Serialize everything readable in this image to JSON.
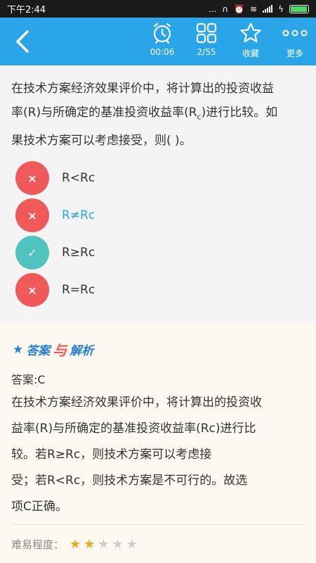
{
  "status_bar": {
    "time": "下午2:44",
    "dots": "...",
    "battery_level": 0.95
  },
  "toolbar": {
    "back_icon": "‹",
    "tools": [
      {
        "icon": "alarm-clock-icon",
        "label": "00:06"
      },
      {
        "icon": "grid-icon",
        "label": "2/55"
      },
      {
        "icon": "star-icon",
        "label": "收藏"
      },
      {
        "icon": "more-icon",
        "label": "更多"
      }
    ]
  },
  "question": {
    "text_line1": "在技术方案经济效果评价中，将计算出的投资收益",
    "text_line2_pre": "率(R)与所确定的基准投资收益率(R",
    "text_line2_sub": "c",
    "text_line2_post": ")进行比较。如",
    "text_line3": "果技术方案可以考虑接受，则(   )。",
    "options": [
      {
        "mark": "×",
        "text": "R<Rc",
        "state": "wrong"
      },
      {
        "mark": "×",
        "text": "R≠Rc",
        "state": "wrong-selected"
      },
      {
        "mark": "✓",
        "text": "R≥Rc",
        "state": "correct"
      },
      {
        "mark": "×",
        "text": "R=Rc",
        "state": "wrong"
      }
    ]
  },
  "answer": {
    "title_star": "★",
    "title_part1": "答案",
    "title_part2": "与",
    "title_part3": "解析",
    "key": "答案:C",
    "analysis_line1": "在技术方案经济效果评价中，将计算出的投资收",
    "analysis_line2": "益率(R)与所确定的基准投资收益率(Rc)进行比",
    "analysis_line3": "较。若R≥Rc，则技术方案可以考虑接",
    "analysis_line4": "受；若R<Rc，则技术方案是不可行的。故选",
    "analysis_line5": "项C正确。",
    "difficulty_label": "难易程度：",
    "difficulty_rating": 2,
    "difficulty_max": 5
  },
  "colors": {
    "primary": "#2aa5e8",
    "wrong": "#f0595a",
    "correct": "#4fc4be",
    "star": "#f5a524"
  }
}
